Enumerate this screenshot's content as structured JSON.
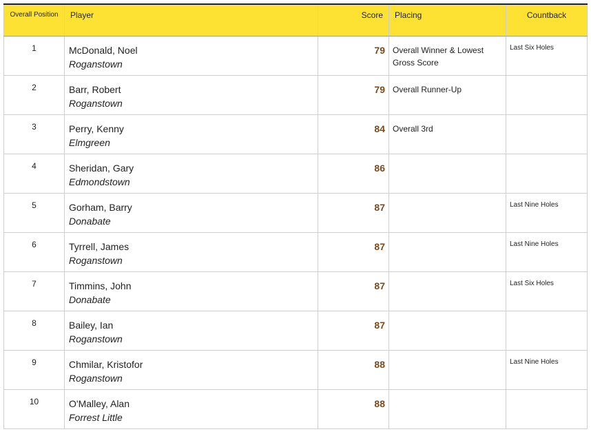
{
  "header": {
    "position": "Overall Position",
    "player": "Player",
    "score": "Score",
    "placing": "Placing",
    "countback": "Countback"
  },
  "rows": [
    {
      "position": "1",
      "name": "McDonald, Noel",
      "club": "Roganstown",
      "score": "79",
      "placing": "Overall Winner & Lowest Gross Score",
      "countback": "Last Six Holes"
    },
    {
      "position": "2",
      "name": "Barr, Robert",
      "club": "Roganstown",
      "score": "79",
      "placing": "Overall Runner-Up",
      "countback": ""
    },
    {
      "position": "3",
      "name": "Perry, Kenny",
      "club": "Elmgreen",
      "score": "84",
      "placing": "Overall 3rd",
      "countback": ""
    },
    {
      "position": "4",
      "name": "Sheridan, Gary",
      "club": "Edmondstown",
      "score": "86",
      "placing": "",
      "countback": ""
    },
    {
      "position": "5",
      "name": "Gorham, Barry",
      "club": "Donabate",
      "score": "87",
      "placing": "",
      "countback": "Last Nine Holes"
    },
    {
      "position": "6",
      "name": "Tyrrell, James",
      "club": "Roganstown",
      "score": "87",
      "placing": "",
      "countback": "Last Nine Holes"
    },
    {
      "position": "7",
      "name": "Timmins, John",
      "club": "Donabate",
      "score": "87",
      "placing": "",
      "countback": "Last Six Holes"
    },
    {
      "position": "8",
      "name": "Bailey, Ian",
      "club": "Roganstown",
      "score": "87",
      "placing": "",
      "countback": ""
    },
    {
      "position": "9",
      "name": "Chmilar, Kristofor",
      "club": "Roganstown",
      "score": "88",
      "placing": "",
      "countback": "Last Nine Holes"
    },
    {
      "position": "10",
      "name": "O'Malley, Alan",
      "club": "Forrest Little",
      "score": "88",
      "placing": "",
      "countback": ""
    }
  ],
  "colors": {
    "header_bg": "#fde233",
    "score_text": "#7a4a1a"
  }
}
